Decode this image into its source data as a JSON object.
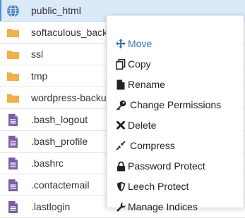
{
  "colors": {
    "selected_row": "#dbeaf9",
    "folder": "#f0b04a",
    "file": "#7b5ea6",
    "globe": "#3a7ac0",
    "move_highlight": "#3a6fb0",
    "menu_text": "#222222"
  },
  "files": [
    {
      "name": "public_html",
      "icon": "globe-icon",
      "selected": true
    },
    {
      "name": "softaculous_backups",
      "icon": "folder-icon"
    },
    {
      "name": "ssl",
      "icon": "folder-icon"
    },
    {
      "name": "tmp",
      "icon": "folder-icon"
    },
    {
      "name": "wordpress-backups",
      "icon": "folder-icon"
    },
    {
      "name": ".bash_logout",
      "icon": "file-icon"
    },
    {
      "name": ".bash_profile",
      "icon": "file-icon"
    },
    {
      "name": ".bashrc",
      "icon": "file-icon"
    },
    {
      "name": ".contactemail",
      "icon": "file-icon"
    },
    {
      "name": ".lastlogin",
      "icon": "file-icon"
    }
  ],
  "context_menu": {
    "items": [
      {
        "label": "Move",
        "icon": "move-icon",
        "highlighted": true
      },
      {
        "label": "Copy",
        "icon": "copy-icon"
      },
      {
        "label": "Rename",
        "icon": "file-icon"
      },
      {
        "label": "Change Permissions",
        "icon": "key-icon"
      },
      {
        "label": "Delete",
        "icon": "x-icon"
      },
      {
        "label": "Compress",
        "icon": "compress-icon"
      },
      {
        "label": "Password Protect",
        "icon": "lock-icon"
      },
      {
        "label": "Leech Protect",
        "icon": "shield-icon"
      },
      {
        "label": "Manage Indices",
        "icon": "wrench-icon"
      }
    ]
  }
}
